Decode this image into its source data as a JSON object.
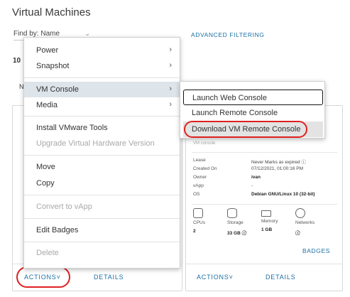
{
  "page": {
    "title": "Virtual Machines"
  },
  "toolbar": {
    "find_by_label": "Find by: Name",
    "advanced_filtering": "ADVANCED FILTERING"
  },
  "list": {
    "count_fragment": "10",
    "header_fragment": "N"
  },
  "context_menu": {
    "items": [
      {
        "label": "Power",
        "submenu": true,
        "disabled": false
      },
      {
        "label": "Snapshot",
        "submenu": true,
        "disabled": false
      },
      {
        "label": "VM Console",
        "submenu": true,
        "disabled": false,
        "active": true
      },
      {
        "label": "Media",
        "submenu": true,
        "disabled": false
      },
      {
        "label": "Install VMware Tools",
        "submenu": false,
        "disabled": false
      },
      {
        "label": "Upgrade Virtual Hardware Version",
        "submenu": false,
        "disabled": true
      },
      {
        "label": "Move",
        "submenu": false,
        "disabled": false
      },
      {
        "label": "Copy",
        "submenu": false,
        "disabled": false
      },
      {
        "label": "Convert to vApp",
        "submenu": false,
        "disabled": true
      },
      {
        "label": "Edit Badges",
        "submenu": false,
        "disabled": false
      },
      {
        "label": "Delete",
        "submenu": false,
        "disabled": true
      }
    ]
  },
  "vm_console_submenu": {
    "items": [
      {
        "label": "Launch Web Console"
      },
      {
        "label": "Launch Remote Console"
      },
      {
        "label": "Download VM Remote Console"
      }
    ]
  },
  "card_left": {
    "actions": "ACTIONS",
    "details": "DETAILS"
  },
  "card_right": {
    "subtitle": "VM console",
    "properties": [
      {
        "key": "Lease",
        "value": "Never Marks as expired ⓘ"
      },
      {
        "key": "Created On",
        "value": "07/12/2021, 01:00:16 PM"
      },
      {
        "key": "Owner",
        "value": "ivan"
      },
      {
        "key": "vApp",
        "value": "-"
      },
      {
        "key": "OS",
        "value": "Debian GNU/Linux 10 (32-bit)"
      }
    ],
    "resources": [
      {
        "icon": "cpu-icon",
        "label": "CPUs",
        "value": "2"
      },
      {
        "icon": "storage-icon",
        "label": "Storage",
        "value": "33 GB ⓘ"
      },
      {
        "icon": "memory-icon",
        "label": "Memory",
        "value": "1 GB"
      },
      {
        "icon": "network-icon",
        "label": "Networks",
        "value": "ⓘ"
      }
    ],
    "badges": "BADGES",
    "actions": "ACTIONS",
    "details": "DETAILS"
  },
  "colors": {
    "link": "#1a6fa3",
    "annotation": "#e02020",
    "menu_active": "#dde4ea"
  }
}
